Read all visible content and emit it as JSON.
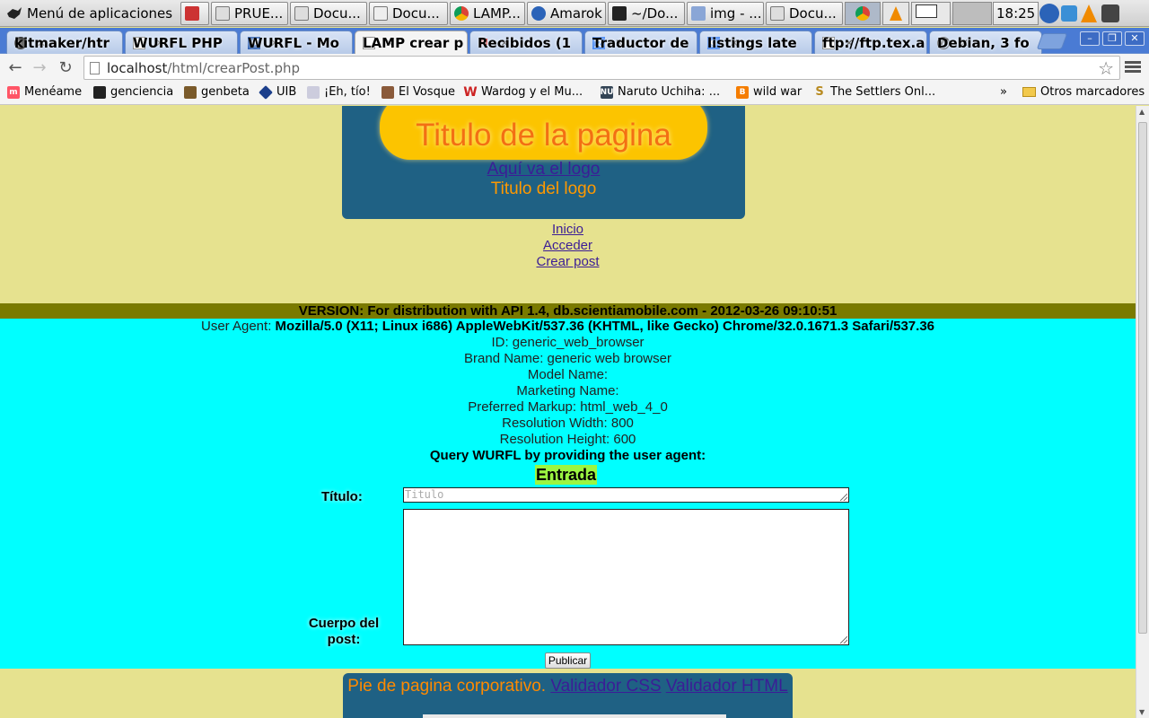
{
  "taskbar": {
    "menu_label": "Menú de aplicaciones",
    "tasks": [
      "PRUE...",
      "Docu...",
      "Docu...",
      "LAMP...",
      "Amarok",
      "~/Do...",
      "img - ...",
      "Docu..."
    ],
    "clock": "18:25"
  },
  "browser": {
    "tabs": [
      "kitmaker/htr",
      "WURFL PHP",
      "WURFL - Mo",
      "LAMP crear p",
      "Recibidos (1",
      "Traductor de",
      "listings late",
      "ftp://ftp.tex.a",
      "Debian, 3 fo"
    ],
    "url_host": "localhost",
    "url_path": "/html/crearPost.php",
    "bookmarks": [
      "Menéame",
      "genciencia",
      "genbeta",
      "UIB",
      "¡Eh, tío!",
      "El Vosque",
      "Wardog y el Mu...",
      "Naruto Uchiha: ...",
      "wild war",
      "The Settlers Onl..."
    ],
    "bookmarks_more": "»",
    "other_bookmarks": "Otros marcadores"
  },
  "page": {
    "header_title": "Titulo de la pagina",
    "logo_link": "Aquí va el logo",
    "logo_title": "Titulo del logo",
    "nav": [
      "Inicio",
      "Acceder",
      "Crear post"
    ],
    "version": "VERSION: For distribution with API 1.4, db.scientiamobile.com - 2012-03-26 09:10:51",
    "user_agent_label": "User Agent:",
    "user_agent_value": "Mozilla/5.0 (X11; Linux i686) AppleWebKit/537.36 (KHTML, like Gecko) Chrome/32.0.1671.3 Safari/537.36",
    "info": [
      "ID: generic_web_browser",
      "Brand Name: generic web browser",
      "Model Name:",
      "Marketing Name:",
      "Preferred Markup: html_web_4_0",
      "Resolution Width: 800",
      "Resolution Height: 600"
    ],
    "query_label": "Query WURFL by providing the user agent:",
    "form_heading": "Entrada",
    "titulo_label": "Título:",
    "titulo_placeholder": "Titulo",
    "cuerpo_label_1": "Cuerpo del",
    "cuerpo_label_2": "post:",
    "publish_button": "Publicar",
    "footer_text": "Pie de pagina corporativo.",
    "footer_links": [
      "Validador CSS",
      "Validador HTML"
    ]
  },
  "colors": {
    "page_bg": "#e6e28f",
    "header_bg": "#1f6184",
    "title_pill": "#fcc400",
    "title_text": "#f36f13",
    "info_bg": "#00ffff",
    "version_bar": "#7a7a00",
    "link": "#3b1d96"
  }
}
